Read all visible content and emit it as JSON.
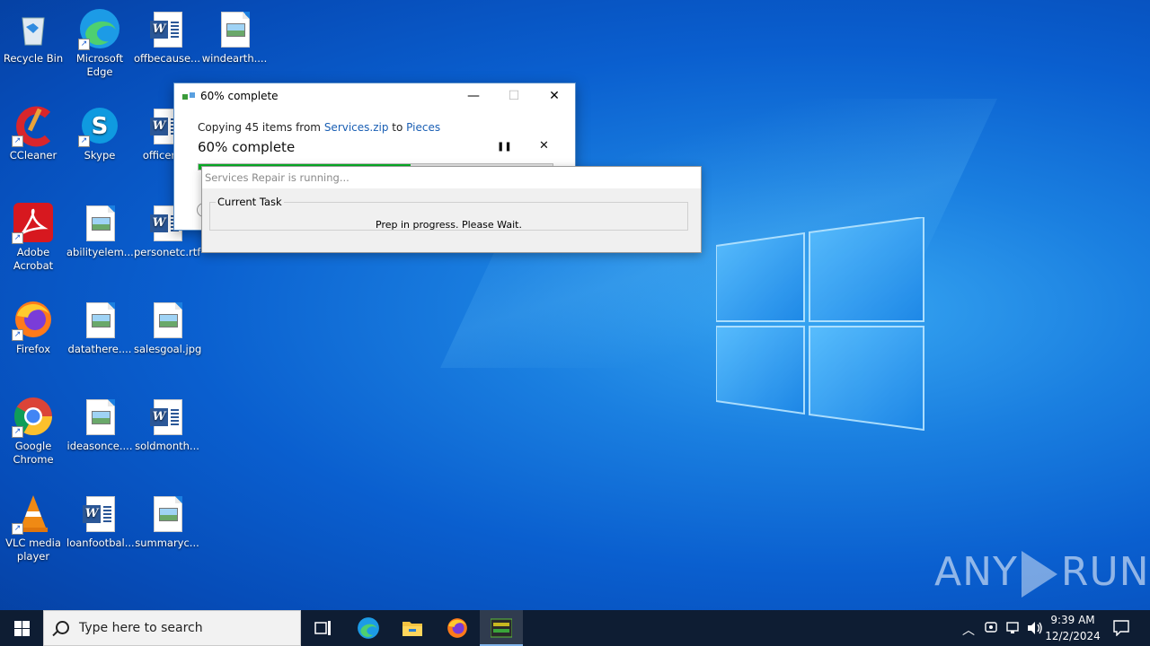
{
  "desktop": {
    "icons": [
      {
        "label": "Recycle Bin",
        "icon": "recycle-bin-icon"
      },
      {
        "label": "Microsoft Edge",
        "icon": "edge-icon"
      },
      {
        "label": "offbecause...",
        "icon": "word-doc-icon"
      },
      {
        "label": "windearth....",
        "icon": "image-file-icon"
      },
      {
        "label": "CCleaner",
        "icon": "ccleaner-icon"
      },
      {
        "label": "Skype",
        "icon": "skype-icon"
      },
      {
        "label": "officera...",
        "icon": "word-doc-icon"
      },
      {
        "label": "Adobe Acrobat",
        "icon": "acrobat-icon"
      },
      {
        "label": "abilityelem...",
        "icon": "image-file-icon"
      },
      {
        "label": "personetc.rtf",
        "icon": "word-doc-icon"
      },
      {
        "label": "Firefox",
        "icon": "firefox-icon"
      },
      {
        "label": "datathere....",
        "icon": "image-file-icon"
      },
      {
        "label": "salesgoal.jpg",
        "icon": "image-file-icon"
      },
      {
        "label": "Google Chrome",
        "icon": "chrome-icon"
      },
      {
        "label": "ideasonce....",
        "icon": "image-file-icon"
      },
      {
        "label": "soldmonth...",
        "icon": "word-doc-icon"
      },
      {
        "label": "VLC media player",
        "icon": "vlc-icon"
      },
      {
        "label": "loanfootbal...",
        "icon": "word-doc-icon"
      },
      {
        "label": "summaryc...",
        "icon": "image-file-icon"
      }
    ]
  },
  "copy_dialog": {
    "title": "60% complete",
    "copying_prefix": "Copying 45 items from ",
    "source": "Services.zip",
    "to_word": " to ",
    "destination": "Pieces",
    "percent_text": "60% complete",
    "progress": 0.6,
    "pause_glyph": "❚❚",
    "cancel_glyph": "✕",
    "minimize_glyph": "—",
    "maximize_glyph": "☐",
    "close_glyph": "✕"
  },
  "repair_dialog": {
    "title": "Services Repair is running...",
    "group_label": "Current Task",
    "task_text": "Prep in progress.  Please Wait."
  },
  "watermark": {
    "text_left": "ANY",
    "text_right": "RUN"
  },
  "taskbar": {
    "search_placeholder": "Type here to search",
    "time": "9:39 AM",
    "date": "12/2/2024",
    "accent": "#0e1d33"
  }
}
